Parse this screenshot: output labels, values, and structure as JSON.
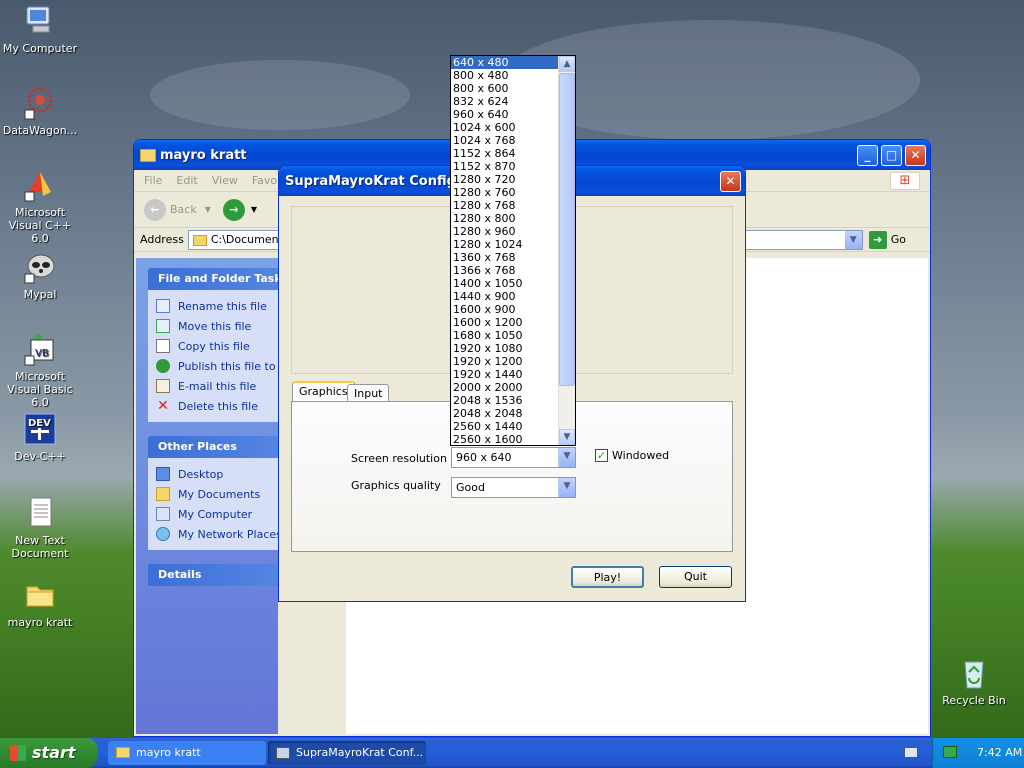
{
  "desktop": {
    "icons": [
      {
        "label": "My Computer"
      },
      {
        "label": "DataWagon..."
      },
      {
        "label": "Microsoft Visual C++ 6.0"
      },
      {
        "label": "Mypal"
      },
      {
        "label": "Microsoft Visual Basic 6.0"
      },
      {
        "label": "Dev-C++"
      },
      {
        "label": "New Text Document"
      },
      {
        "label": "mayro kratt"
      },
      {
        "label": "Recycle Bin"
      }
    ]
  },
  "explorer": {
    "title": "mayro kratt",
    "menu": [
      "File",
      "Edit",
      "View",
      "Favo"
    ],
    "back_label": "Back",
    "address_label": "Address",
    "address_value": "C:\\Documents",
    "go_label": "Go",
    "file_tasks": {
      "title": "File and Folder Tasks",
      "items": [
        "Rename this file",
        "Move this file",
        "Copy this file",
        "Publish this file to th",
        "E-mail this file",
        "Delete this file"
      ]
    },
    "other_places": {
      "title": "Other Places",
      "items": [
        "Desktop",
        "My Documents",
        "My Computer",
        "My Network Places"
      ]
    },
    "details_title": "Details"
  },
  "dialog": {
    "title": "SupraMayroKrat Configurat",
    "tabs": [
      "Graphics",
      "Input"
    ],
    "resolution_label": "Screen resolution",
    "resolution_value": "960 x 640",
    "windowed_label": "Windowed",
    "windowed_checked": true,
    "quality_label": "Graphics quality",
    "quality_value": "Good",
    "play_label": "Play!",
    "quit_label": "Quit"
  },
  "resolutions": {
    "selected_index": 0,
    "options": [
      "640 x 480",
      "800 x 480",
      "800 x 600",
      "832 x 624",
      "960 x 640",
      "1024 x 600",
      "1024 x 768",
      "1152 x 864",
      "1152 x 870",
      "1280 x 720",
      "1280 x 760",
      "1280 x 768",
      "1280 x 800",
      "1280 x 960",
      "1280 x 1024",
      "1360 x 768",
      "1366 x 768",
      "1400 x 1050",
      "1440 x 900",
      "1600 x 900",
      "1600 x 1200",
      "1680 x 1050",
      "1920 x 1080",
      "1920 x 1200",
      "1920 x 1440",
      "2000 x 2000",
      "2048 x 1536",
      "2048 x 2048",
      "2560 x 1440",
      "2560 x 1600"
    ]
  },
  "taskbar": {
    "start_label": "start",
    "tasks": [
      {
        "label": "mayro kratt"
      },
      {
        "label": "SupraMayroKrat Conf..."
      }
    ],
    "clock": "7:42 AM"
  },
  "colors": {
    "xp_blue": "#0348d0",
    "selection": "#316ac5",
    "start_green": "#2f8a2f"
  }
}
